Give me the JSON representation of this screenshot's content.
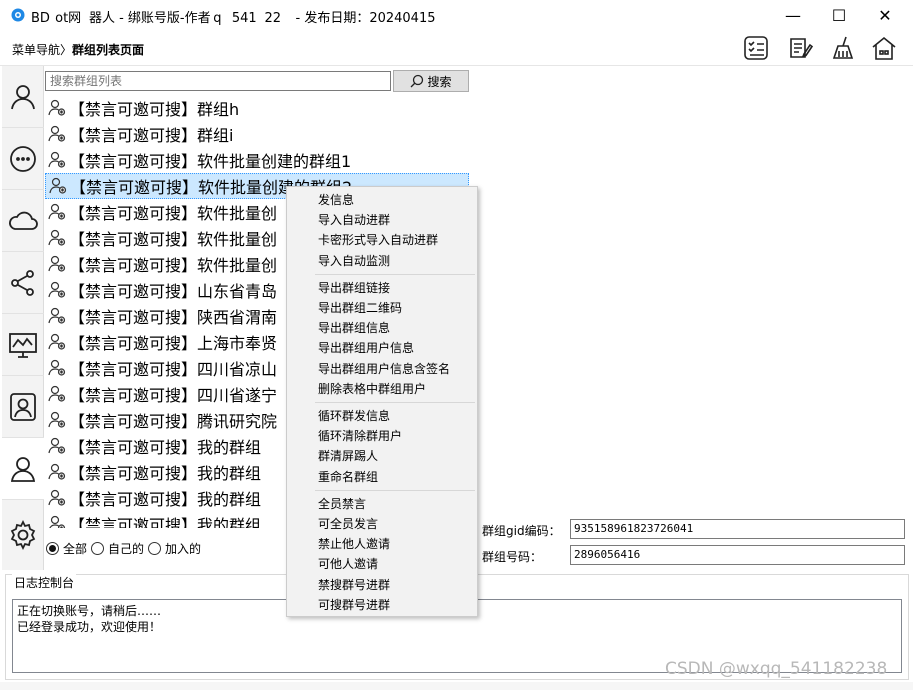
{
  "window": {
    "title": "BD  ot网   器人 - 绑账号版-作者 q    541   22     - 发布日期：20240415",
    "min_glyph": "—",
    "max_glyph": "☐",
    "close_glyph": "✕"
  },
  "nav": {
    "root": "菜单导航",
    "separator": "〉",
    "current": "群组列表页面",
    "tools": [
      "checklist-icon",
      "notes-edit-icon",
      "broom-icon",
      "home-icon"
    ]
  },
  "sidebar": {
    "items": [
      "user-icon",
      "chat-bubble-icon",
      "cloud-icon",
      "share-icon",
      "monitor-chart-icon",
      "contact-card-icon",
      "user-outline-icon",
      "gear-icon"
    ],
    "active_index": 6
  },
  "search": {
    "placeholder": "搜索群组列表",
    "button_label": "搜索"
  },
  "groups": [
    "【禁言可邀可搜】群组h",
    "【禁言可邀可搜】群组i",
    "【禁言可邀可搜】软件批量创建的群组1",
    "【禁言可邀可搜】软件批量创建的群组2",
    "【禁言可邀可搜】软件批量创",
    "【禁言可邀可搜】软件批量创",
    "【禁言可邀可搜】软件批量创",
    "【禁言可邀可搜】山东省青岛",
    "【禁言可邀可搜】陕西省渭南",
    "【禁言可邀可搜】上海市奉贤",
    "【禁言可邀可搜】四川省凉山",
    "【禁言可邀可搜】四川省遂宁",
    "【禁言可邀可搜】腾讯研究院",
    "【禁言可邀可搜】我的群组",
    "【禁言可邀可搜】我的群组",
    "【禁言可邀可搜】我的群组",
    "【禁言可邀可搜】我的群组"
  ],
  "selected_group_index": 3,
  "filter": {
    "options": [
      "全部",
      "自己的",
      "加入的"
    ],
    "selected": 0
  },
  "details": {
    "gid_label": "群组gid编码：",
    "gid_value": "935158961823726041",
    "number_label": "群组号码：",
    "number_value": "2896056416"
  },
  "log": {
    "title": "日志控制台",
    "lines": [
      "正在切换账号，请稍后……",
      "已经登录成功，欢迎使用！"
    ]
  },
  "context_menu": {
    "sections": [
      [
        "发信息",
        "导入自动进群",
        "卡密形式导入自动进群",
        "导入自动监测"
      ],
      [
        "导出群组链接",
        "导出群组二维码",
        "导出群组信息",
        "导出群组用户信息",
        "导出群组用户信息含签名",
        "删除表格中群组用户"
      ],
      [
        "循环群发信息",
        "循环清除群用户",
        "群清屏踢人",
        "重命名群组"
      ],
      [
        "全员禁言",
        "可全员发言",
        "禁止他人邀请",
        "可他人邀请",
        "禁搜群号进群",
        "可搜群号进群"
      ]
    ]
  },
  "watermark": "CSDN @wxqq_541182238",
  "colors": {
    "selection": "#cce8ff",
    "app_icon": "#1e88e5"
  }
}
